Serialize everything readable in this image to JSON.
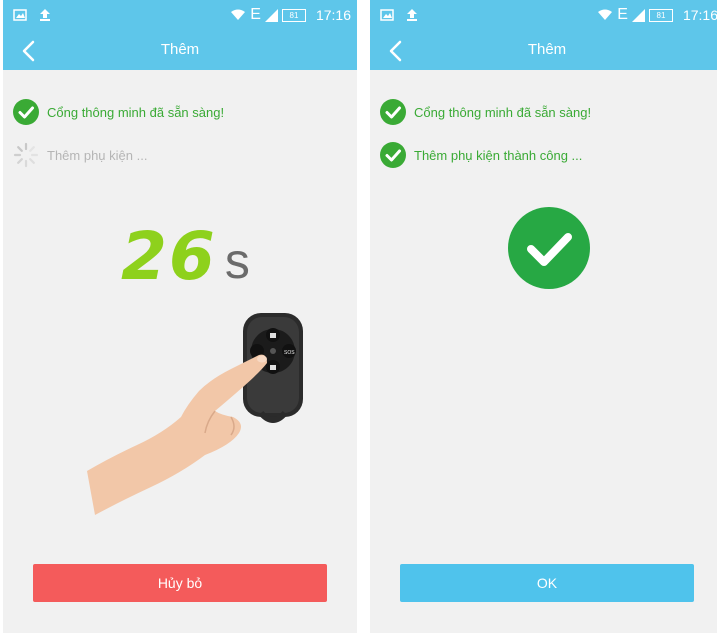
{
  "colors": {
    "header": "#5ec6ea",
    "success": "#3aaa35",
    "countdown": "#8ed11c",
    "cancel": "#f45b5b",
    "ok": "#4fc3ec"
  },
  "status_bar": {
    "network": "E",
    "battery": "81",
    "time": "17:16"
  },
  "screen1": {
    "title": "Thêm",
    "step1": "Cổng thông minh đã sẵn sàng!",
    "step2": "Thêm phụ kiện ...",
    "countdown_value": "26",
    "countdown_unit": "s",
    "fob_sos": "SOS",
    "cancel_label": "Hủy bỏ"
  },
  "screen2": {
    "title": "Thêm",
    "step1": "Cổng thông minh đã sẵn sàng!",
    "step2": "Thêm phụ kiện thành công ...",
    "ok_label": "OK"
  }
}
